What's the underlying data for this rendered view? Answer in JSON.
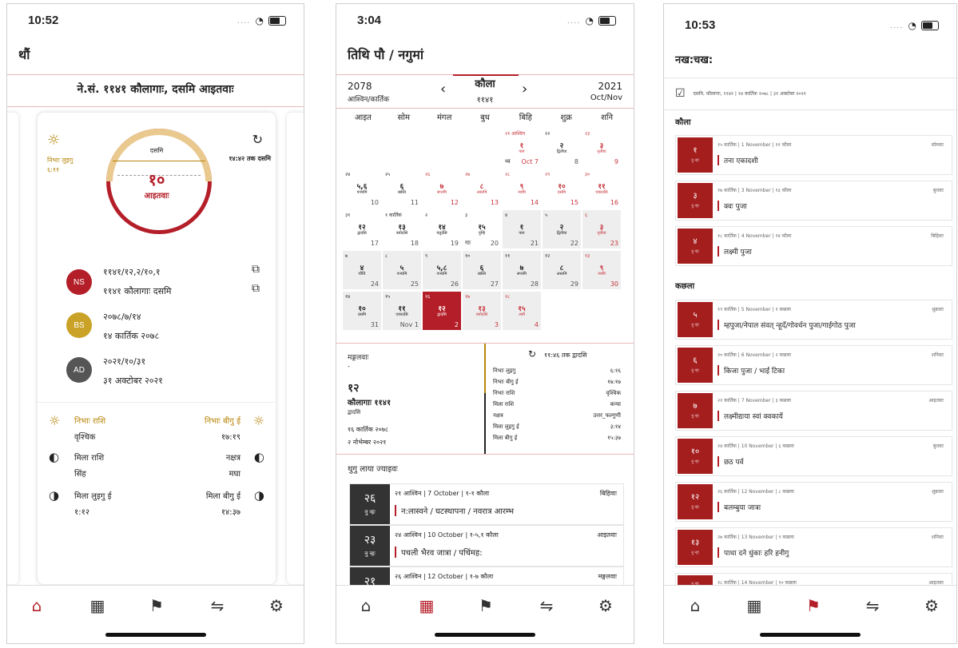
{
  "screen1": {
    "time": "10:52",
    "title": "थौं",
    "date_header": "ने.सं. ११४१ कौलागाः, दसमि आइतवाः",
    "sunrise_label": "निभाः लुइगु",
    "sunrise_time": "६:११",
    "tithi_top": "दसमि",
    "tithi_end": "१४:४२ तक दसमि",
    "day_number": "१०",
    "day_name": "आइतवाः",
    "ns_badge": "NS",
    "ns_line1": "११४१/१२,२/१०,१",
    "ns_line2": "११४१ कौलागाः दसमि",
    "bs_badge": "BS",
    "bs_line1": "२०७८/७/१४",
    "bs_line2": "१४ कार्तिक २०७८",
    "ad_badge": "AD",
    "ad_line1": "२०२१/१०/३१",
    "ad_line2": "३१ अक्टोबर २०२१",
    "sun_rashi_label": "निभाः राशि",
    "sun_rashi_value": "वृश्चिक",
    "sunset_label": "निभाः बीगु ई",
    "sunset_value": "१७:१९",
    "moon_rashi_label": "मिला राशि",
    "moon_rashi_value": "सिंह",
    "nakshatra_label": "नक्षत्र",
    "nakshatra_value": "मघा",
    "moonrise_label": "मिला लुइगु ई",
    "moonrise_value": "१:१२",
    "moonset_label": "मिला बीगु ई",
    "moonset_value": "१४:३७"
  },
  "screen2": {
    "time": "3:04",
    "title": "तिथि पौ / नगुमां",
    "left_year": "2078",
    "left_months": "आश्विन/कार्तिक",
    "mid_month": "कौला",
    "mid_year": "११४१",
    "right_year": "2021",
    "right_months": "Oct/Nov",
    "weekdays": [
      "आइत",
      "सोम",
      "मंगल",
      "बुध",
      "बिहि",
      "शुक्र",
      "शनि"
    ],
    "cells": [
      {
        "c": 4,
        "r": 0,
        "tl": "२१ आश्विन",
        "md": "१",
        "ms": "पारु",
        "br": "Oct 7",
        "extra": "थ्व",
        "hol": true
      },
      {
        "c": 5,
        "r": 0,
        "tl": "२२",
        "md": "२",
        "ms": "द्वितीया",
        "br": "8"
      },
      {
        "c": 6,
        "r": 0,
        "tl": "२३",
        "md": "३",
        "ms": "तृतीया",
        "br": "9",
        "hol": true
      },
      {
        "c": 0,
        "r": 1,
        "tl": "२४",
        "md": "५,६",
        "ms": "पञ्चमि",
        "br": "10"
      },
      {
        "c": 1,
        "r": 1,
        "tl": "२५",
        "md": "६",
        "ms": "खस्ति",
        "br": "11"
      },
      {
        "c": 2,
        "r": 1,
        "tl": "२६",
        "md": "७",
        "ms": "सप्तमि",
        "br": "12",
        "hol": true
      },
      {
        "c": 3,
        "r": 1,
        "tl": "२७",
        "md": "८",
        "ms": "अस्तमि",
        "br": "13",
        "hol": true
      },
      {
        "c": 4,
        "r": 1,
        "tl": "२८",
        "md": "९",
        "ms": "नवमि",
        "br": "14",
        "hol": true
      },
      {
        "c": 5,
        "r": 1,
        "tl": "२९",
        "md": "१०",
        "ms": "दसमि",
        "br": "15",
        "hol": true
      },
      {
        "c": 6,
        "r": 1,
        "tl": "३०",
        "md": "११",
        "ms": "एकादसि",
        "br": "16",
        "hol": true
      },
      {
        "c": 0,
        "r": 2,
        "tl": "३१",
        "md": "१२",
        "ms": "द्वादसि",
        "br": "17"
      },
      {
        "c": 1,
        "r": 2,
        "tl": "१ कार्तिक",
        "md": "१३",
        "ms": "त्रयोदसि",
        "br": "18"
      },
      {
        "c": 2,
        "r": 2,
        "tl": "२",
        "md": "१४",
        "ms": "चतुर्दसि",
        "br": "19"
      },
      {
        "c": 3,
        "r": 2,
        "tl": "३",
        "md": "१५",
        "ms": "पुन्हि",
        "br": "20",
        "extra": "गाः"
      },
      {
        "c": 4,
        "r": 2,
        "tl": "४",
        "md": "१",
        "ms": "पारु",
        "br": "21",
        "sh": true
      },
      {
        "c": 5,
        "r": 2,
        "tl": "५",
        "md": "२",
        "ms": "द्वितीया",
        "br": "22",
        "sh": true
      },
      {
        "c": 6,
        "r": 2,
        "tl": "६",
        "md": "३",
        "ms": "तृतीया",
        "br": "23",
        "sh": true,
        "hol": true
      },
      {
        "c": 0,
        "r": 3,
        "tl": "७",
        "md": "४",
        "ms": "चौथि",
        "br": "24",
        "sh": true
      },
      {
        "c": 1,
        "r": 3,
        "tl": "८",
        "md": "५",
        "ms": "पञ्चमि",
        "br": "25",
        "sh": true
      },
      {
        "c": 2,
        "r": 3,
        "tl": "९",
        "md": "५,८",
        "ms": "पञ्चमि",
        "br": "26",
        "sh": true
      },
      {
        "c": 3,
        "r": 3,
        "tl": "१०",
        "md": "६",
        "ms": "खस्ति",
        "br": "27",
        "sh": true
      },
      {
        "c": 4,
        "r": 3,
        "tl": "११",
        "md": "७",
        "ms": "सप्तमि",
        "br": "28",
        "sh": true
      },
      {
        "c": 5,
        "r": 3,
        "tl": "१२",
        "md": "८",
        "ms": "अस्तमि",
        "br": "29",
        "sh": true
      },
      {
        "c": 6,
        "r": 3,
        "tl": "१३",
        "md": "९",
        "ms": "नवमि",
        "br": "30",
        "sh": true,
        "hol": true
      },
      {
        "c": 0,
        "r": 4,
        "tl": "१४",
        "md": "१०",
        "ms": "दसमि",
        "br": "31",
        "sh": true
      },
      {
        "c": 1,
        "r": 4,
        "tl": "१५",
        "md": "११",
        "ms": "एकादसि",
        "br": "Nov 1",
        "sh": true
      },
      {
        "c": 2,
        "r": 4,
        "tl": "१६",
        "md": "१२",
        "ms": "द्वादसि",
        "br": "2",
        "sel": true
      },
      {
        "c": 3,
        "r": 4,
        "tl": "१७",
        "md": "१३",
        "ms": "त्रयोदसि",
        "br": "3",
        "sh": true,
        "hol": true
      },
      {
        "c": 4,
        "r": 4,
        "tl": "१८",
        "md": "१५",
        "ms": "आमै",
        "br": "4",
        "sh": true,
        "hol": true
      }
    ],
    "detail": {
      "weekday": "मङ्गलवाः",
      "dash": "-",
      "num": "१२",
      "month_year": "कौलागाः ११४१",
      "tithi": "द्वादसि",
      "bs_date": "१६ कार्तिक २०७८",
      "ad_date": "२ नोभेम्बर २०२१",
      "tithi_end": "११:४६ तक द्वादसि",
      "rows": [
        {
          "k": "निभाः लुइगु",
          "v": "६:१६"
        },
        {
          "k": "निभाः बीगु ई",
          "v": "१७:१७"
        },
        {
          "k": "निभाः राशि",
          "v": "वृश्चिक"
        },
        {
          "k": "मिला राशि",
          "v": "कन्या"
        },
        {
          "k": "नक्षत्र",
          "v": "उत्तर_फल्गुणी"
        },
        {
          "k": "मिला लुइगु ई",
          "v": "३:१४"
        },
        {
          "k": "मिला बीगु ई",
          "v": "१५:३७"
        }
      ]
    },
    "events_heading": "थुगु लाया ज्याइवः",
    "events": [
      {
        "num": "२६",
        "sub": "नु न्हः",
        "meta": "२१ आश्विन | 7 October | १-१ कौला",
        "day": "बिहिवाः",
        "name": "न:लास्वने / घटस्थापना / नवरात्र आरम्भ"
      },
      {
        "num": "२३",
        "sub": "नु न्हः",
        "meta": "२४ आश्विन | 10 October | १-५,१ कौला",
        "day": "आइतवाः",
        "name": "पचली भैरव जात्रा / पचिंमह:"
      },
      {
        "num": "२१",
        "sub": "",
        "meta": "२६ आश्विन | 12 October | १-७ कौला",
        "day": "मङ्गलवाः",
        "name": ""
      }
    ]
  },
  "screen3": {
    "time": "10:53",
    "title": "नख:चख:",
    "top_info": "दसमि, कौलागाः, ११४१ | १४ कार्तिक २०७८ | ३१ अक्टोबर २०२१",
    "section1": "कौला",
    "section2": "कछला",
    "events": [
      {
        "sec": 1,
        "num": "१",
        "meta": "१५ कार्तिक | 1 November | ११ कौला",
        "day": "सोमवाः",
        "name": "तना एकादशी"
      },
      {
        "sec": 1,
        "num": "३",
        "meta": "१७ कार्तिक | 3 November | १३ कौला",
        "day": "बुधवाः",
        "name": "क्वः पुजा"
      },
      {
        "sec": 1,
        "num": "४",
        "meta": "१८ कार्तिक | 4 November | १४ कौला",
        "day": "बिहिवाः",
        "name": "लक्ष्मी पुजा"
      },
      {
        "sec": 2,
        "num": "५",
        "meta": "१९ कार्तिक | 5 November | १ कछला",
        "day": "शुक्रवाः",
        "name": "म्हपुजा/नेपाल संवत् न्हूदँ/गोवर्धन पुजा/गाईगोठ पुजा"
      },
      {
        "sec": 2,
        "num": "६",
        "meta": "२० कार्तिक | 6 November | २ कछला",
        "day": "शनिवाः",
        "name": "किजा पुजा / भाई टिका"
      },
      {
        "sec": 2,
        "num": "७",
        "meta": "२१ कार्तिक | 7 November | ३ कछला",
        "day": "आइतवाः",
        "name": "लक्ष्मीद्यःया स्वां क्वकायें"
      },
      {
        "sec": 2,
        "num": "१०",
        "meta": "२४ कार्तिक | 10 November | ६ कछला",
        "day": "बुधवाः",
        "name": "छठ पर्व"
      },
      {
        "sec": 2,
        "num": "१२",
        "meta": "२६ कार्तिक | 12 November | ८ कछला",
        "day": "शुक्रवाः",
        "name": "बलम्बुया जात्रा"
      },
      {
        "sec": 2,
        "num": "१३",
        "meta": "२७ कार्तिक | 13 November | ९ कछला",
        "day": "शनिवाः",
        "name": "पाथा दने धुंकाः हरि हनीगु"
      },
      {
        "sec": 2,
        "num": "",
        "meta": "२८ कार्तिक | 14 November | १० कछला",
        "day": "आइतवाः",
        "name": ""
      }
    ],
    "img_sub": "नु न्हः"
  },
  "colors": {
    "accent": "#b41e28",
    "gold": "#b8860b",
    "ns": "#b41e28",
    "bs": "#c9a227",
    "ad": "#555555"
  },
  "icons": [
    "home-icon",
    "calendar-icon",
    "festival-icon",
    "convert-icon",
    "gear-icon"
  ]
}
